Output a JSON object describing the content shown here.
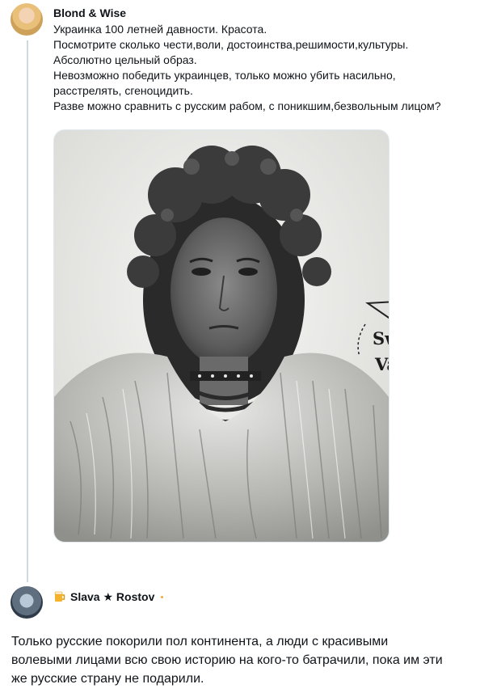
{
  "post": {
    "author": "Blond & Wise",
    "avatar_icon": "avatar-photo",
    "lines": [
      "Украинка 100 летней давности. Красота.",
      "Посмотрите сколько чести,воли, достоинства,решимости,культуры.",
      "Абсолютно цельный образ.",
      "Невозможно победить украинцев, только можно убить насильно,",
      "расстрелять, сгеноцидить.",
      "Разве можно сравнить с русским рабом, с поникшим,безвольным лицом?"
    ],
    "image": {
      "watermark_line1": "Swiss",
      "watermark_line2": "Vatnik",
      "watermark_icon": "paper-plane-icon"
    }
  },
  "reply": {
    "author": "Slava ★ Rostov",
    "avatar_icon": "avatar-photo",
    "badge_icon": "beer-mug-icon",
    "lines": [
      "Только русские покорили пол континента, а люди с красивыми",
      "волевыми лицами всю свою историю на кого-то батрачили, пока им эти",
      "же русские страну не подарили."
    ]
  },
  "colors": {
    "thread_line": "#cfd9de",
    "text": "#0f1419",
    "badge_accent": "#f4a83a"
  }
}
